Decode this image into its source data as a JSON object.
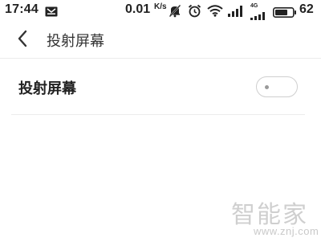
{
  "status_bar": {
    "time": "17:44",
    "net_speed": "0.01",
    "net_speed_unit": "K/s",
    "network_type": "4G",
    "battery_level": "62",
    "icons": [
      "message-icon",
      "silent-bell-icon",
      "alarm-clock-icon",
      "wifi-icon",
      "signal-icon",
      "signal-4g-icon",
      "battery-icon"
    ]
  },
  "header": {
    "title": "投射屏幕",
    "back_icon": "chevron-left-icon"
  },
  "settings": {
    "items": [
      {
        "label": "投射屏幕",
        "toggle_on": false
      }
    ]
  },
  "watermark": {
    "mark": "智能家",
    "url": "www.znj.com"
  }
}
